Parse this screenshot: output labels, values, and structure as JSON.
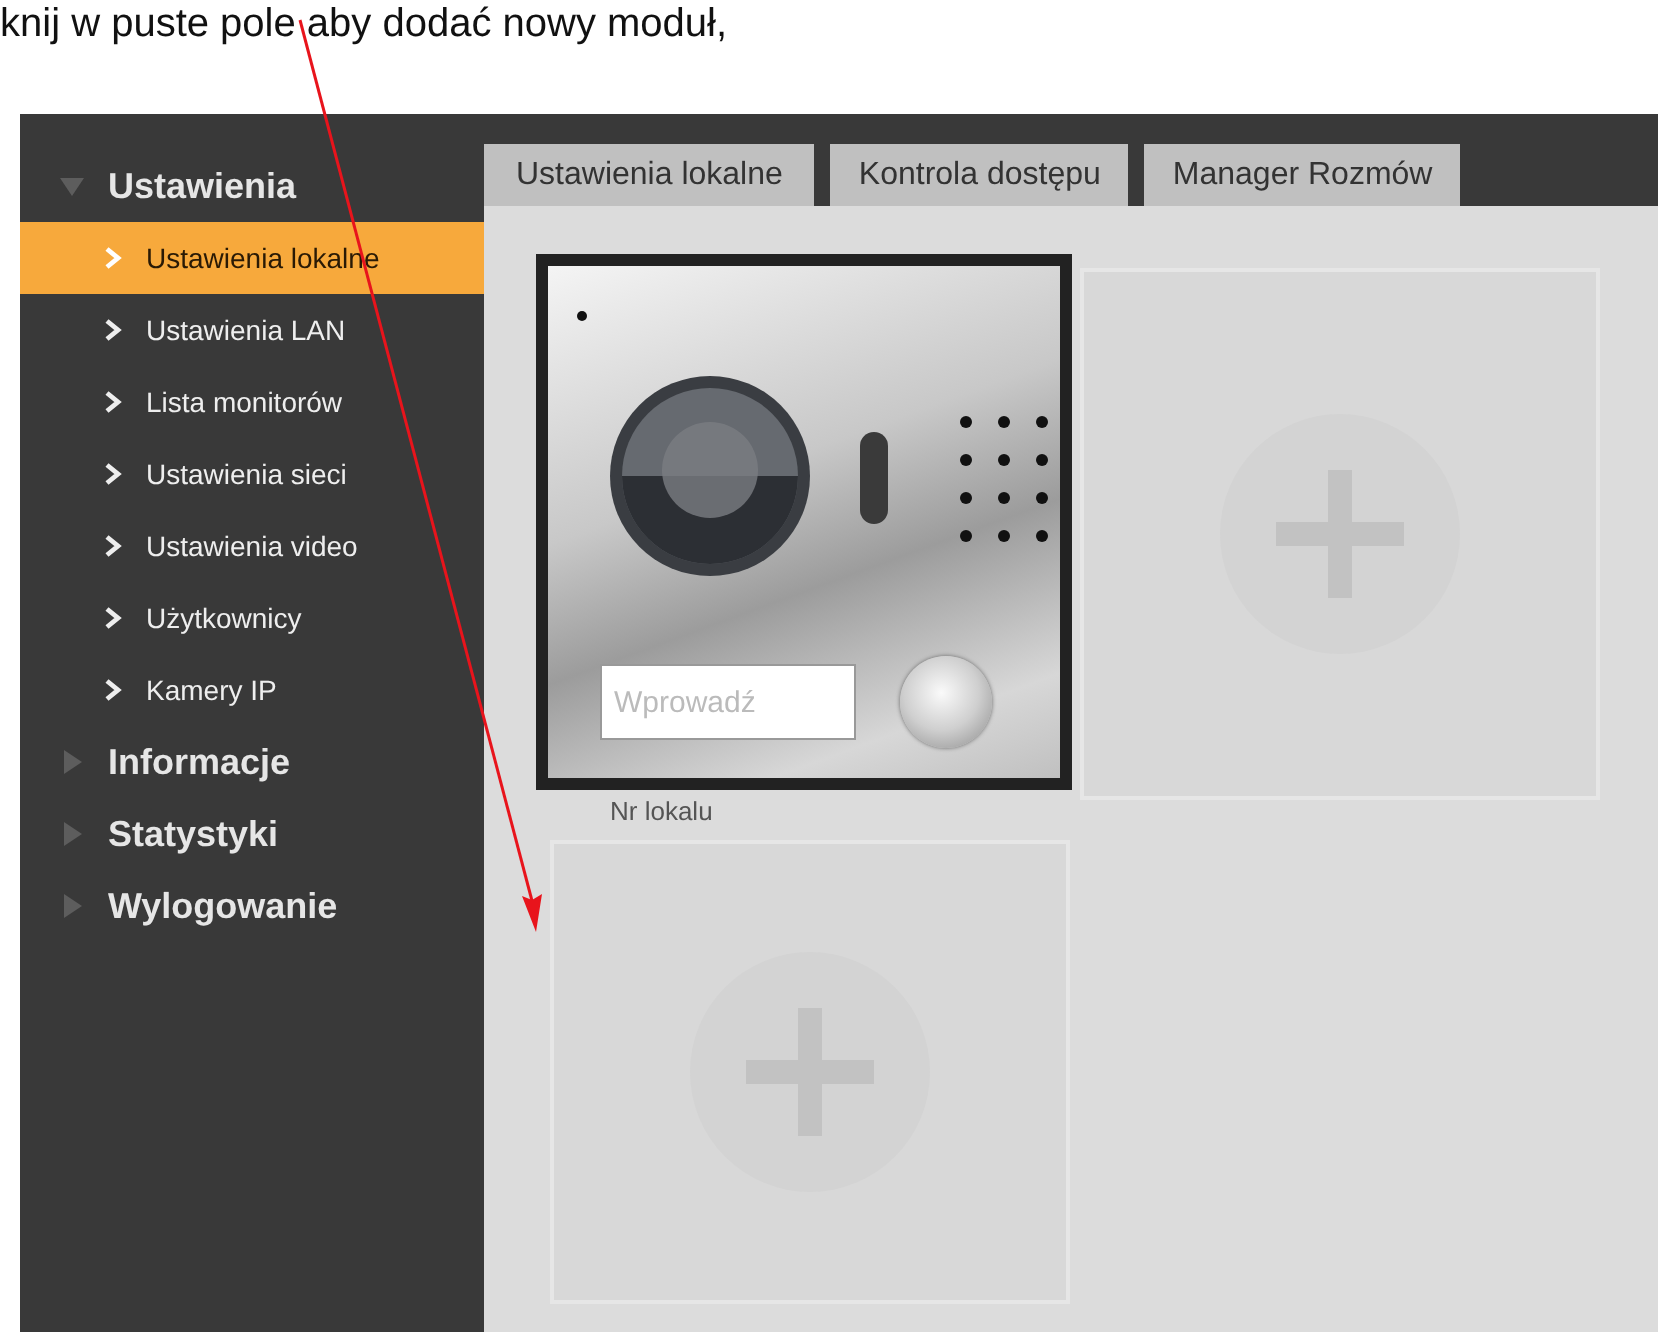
{
  "caption": "knij w puste pole aby dodać nowy moduł,",
  "sidebar": {
    "sections": [
      {
        "label": "Ustawienia",
        "expanded": true,
        "children": [
          {
            "label": "Ustawienia lokalne",
            "selected": true
          },
          {
            "label": "Ustawienia LAN",
            "selected": false
          },
          {
            "label": "Lista monitorów",
            "selected": false
          },
          {
            "label": "Ustawienia sieci",
            "selected": false
          },
          {
            "label": "Ustawienia video",
            "selected": false
          },
          {
            "label": "Użytkownicy",
            "selected": false
          },
          {
            "label": "Kamery IP",
            "selected": false
          }
        ]
      },
      {
        "label": "Informacje",
        "expanded": false
      },
      {
        "label": "Statystyki",
        "expanded": false
      },
      {
        "label": "Wylogowanie",
        "expanded": false
      }
    ]
  },
  "tabs": [
    {
      "label": "Ustawienia lokalne"
    },
    {
      "label": "Kontrola dostępu"
    },
    {
      "label": "Manager Rozmów"
    }
  ],
  "modules": [
    {
      "kind": "door-station",
      "placeholder": "Wprowadź",
      "label": "Nr lokalu"
    },
    {
      "kind": "empty"
    },
    {
      "kind": "empty"
    }
  ]
}
